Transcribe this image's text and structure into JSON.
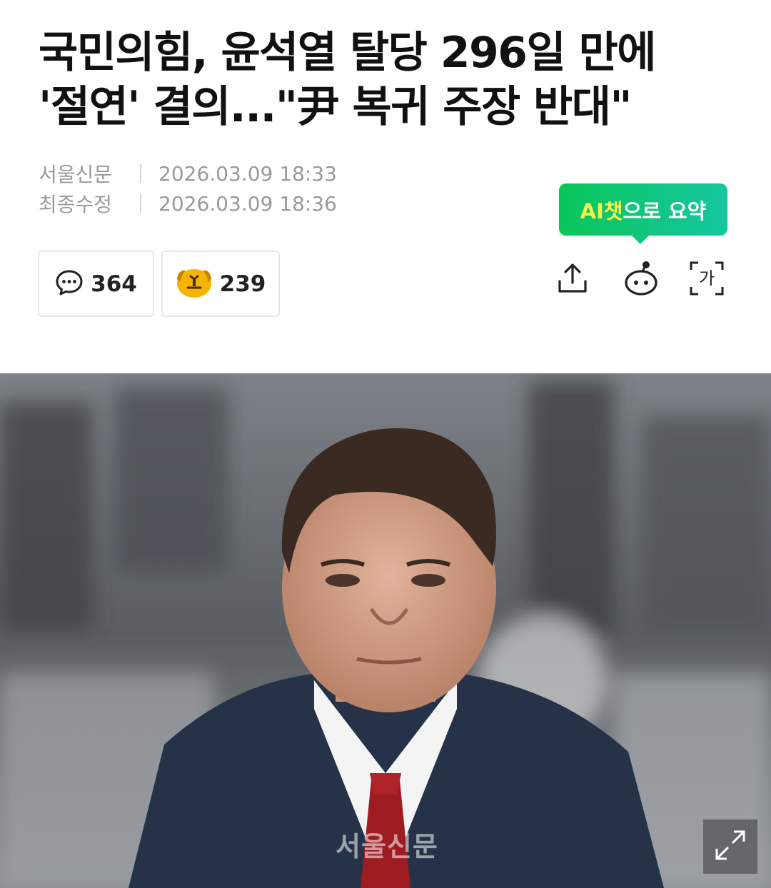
{
  "article": {
    "headline": "국민의힘, 윤석열 탈당 296일 만에 '절연' 결의...\"尹 복귀 주장 반대\"",
    "publisher": "서울신문",
    "published_label_time": "2026.03.09 18:33",
    "modified_label": "최종수정",
    "modified_time": "2026.03.09 18:36"
  },
  "ai_summary": {
    "prefix": "AI챗",
    "suffix": "으로 요약"
  },
  "reactions": {
    "comments_count": "364",
    "likes_count": "239"
  },
  "toolbar": {
    "share_icon": "share-icon",
    "ai-bot_icon": "ai-bot-icon",
    "font_size_icon": "font-size-icon",
    "font_size_glyph": "가"
  },
  "photo": {
    "watermark": "서울신문"
  },
  "colors": {
    "ai_green": "#0bc65a",
    "ai_highlight": "#f5f34a",
    "meta_gray": "#9a9a9a"
  }
}
